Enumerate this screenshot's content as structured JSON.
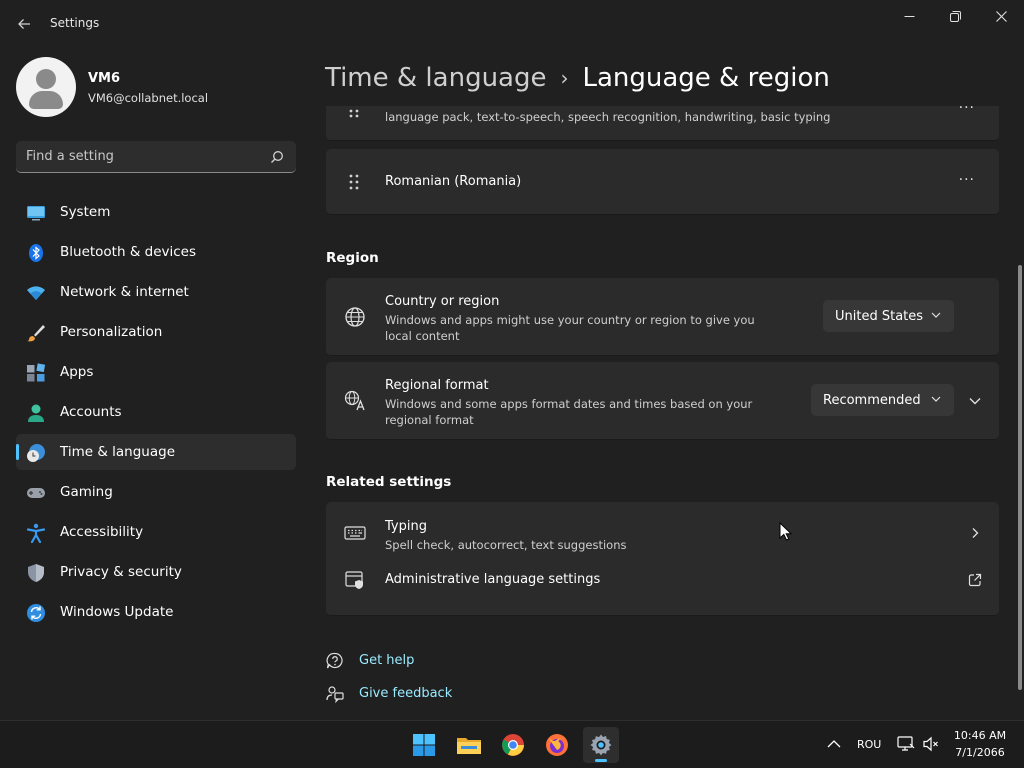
{
  "window": {
    "title": "Settings",
    "back_icon": "back-arrow-icon",
    "minimize_glyph": "—",
    "maximize_glyph": "❐",
    "close_glyph": "✕"
  },
  "profile": {
    "name": "VM6",
    "email": "VM6@collabnet.local"
  },
  "search": {
    "placeholder": "Find a setting"
  },
  "sidebar": {
    "items": [
      {
        "label": "System",
        "icon": "monitor-icon"
      },
      {
        "label": "Bluetooth & devices",
        "icon": "bluetooth-icon"
      },
      {
        "label": "Network & internet",
        "icon": "wifi-icon"
      },
      {
        "label": "Personalization",
        "icon": "brush-icon"
      },
      {
        "label": "Apps",
        "icon": "apps-icon"
      },
      {
        "label": "Accounts",
        "icon": "person-icon"
      },
      {
        "label": "Time & language",
        "icon": "clock-globe-icon"
      },
      {
        "label": "Gaming",
        "icon": "gamepad-icon"
      },
      {
        "label": "Accessibility",
        "icon": "accessibility-icon"
      },
      {
        "label": "Privacy & security",
        "icon": "shield-icon"
      },
      {
        "label": "Windows Update",
        "icon": "update-icon"
      }
    ],
    "active_index": 6
  },
  "header": {
    "parent": "Time & language",
    "separator": "›",
    "current": "Language & region"
  },
  "languages": {
    "partial_desc": "language pack, text-to-speech, speech recognition, handwriting, basic typing",
    "romanian": "Romanian (Romania)",
    "more_glyph": "···"
  },
  "region": {
    "section_title": "Region",
    "country": {
      "title": "Country or region",
      "desc": "Windows and apps might use your country or region to give you local content",
      "value": "United States"
    },
    "format": {
      "title": "Regional format",
      "desc": "Windows and some apps format dates and times based on your regional format",
      "value": "Recommended"
    }
  },
  "related": {
    "section_title": "Related settings",
    "typing": {
      "title": "Typing",
      "desc": "Spell check, autocorrect, text suggestions"
    },
    "admin": {
      "title": "Administrative language settings"
    }
  },
  "help": {
    "get_help": "Get help",
    "give_feedback": "Give feedback"
  },
  "taskbar": {
    "apps": [
      "start-icon",
      "file-explorer-icon",
      "chrome-icon",
      "firefox-icon",
      "settings-icon"
    ],
    "language": "ROU",
    "time": "10:46 AM",
    "date": "7/1/2066"
  },
  "colors": {
    "accent": "#4cc2ff",
    "link": "#99ebff",
    "background": "#202020",
    "card": "#2b2b2b"
  }
}
